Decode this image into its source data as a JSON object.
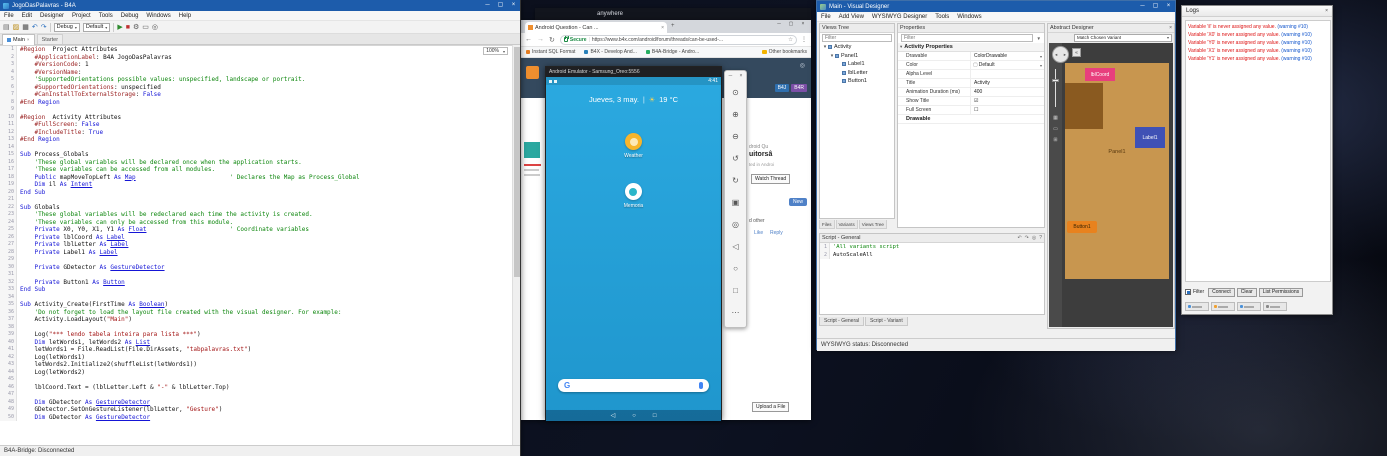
{
  "glyphs": {
    "minimize": "─",
    "maximize": "▢",
    "close": "×",
    "dropdown": "▾",
    "back": "←",
    "forward": "→",
    "reload": "↻",
    "star": "☆",
    "overflow": "⋮",
    "newtab": "+",
    "left_collapse": "«",
    "search": "◎",
    "dpad_left": "◂",
    "dpad_right": "▸",
    "funnel": "▼",
    "expander": "▾"
  },
  "background_window": {
    "title": "anywhere"
  },
  "ide": {
    "title": "JogoDasPalavras - B4A",
    "menus": [
      "File",
      "Edit",
      "Designer",
      "Project",
      "Tools",
      "Debug",
      "Windows",
      "Help"
    ],
    "toolbar_icons_left": [
      {
        "name": "new-file-icon",
        "glyph": "▤",
        "color": "#666"
      },
      {
        "name": "open-file-icon",
        "glyph": "▨",
        "color": "#b8860b"
      },
      {
        "name": "save-icon",
        "glyph": "▦",
        "color": "#444"
      },
      {
        "name": "undo-icon",
        "glyph": "↶",
        "color": "#2a6fbf"
      },
      {
        "name": "redo-icon",
        "glyph": "↷",
        "color": "#2a6fbf"
      }
    ],
    "build_config": "Debug",
    "profile": "Default",
    "toolbar_icons_right": [
      {
        "name": "run-icon",
        "glyph": "▶",
        "color": "#2e8b2e"
      },
      {
        "name": "stop-icon",
        "glyph": "■",
        "color": "#c03030"
      },
      {
        "name": "compile-icon",
        "glyph": "⚙",
        "color": "#555"
      },
      {
        "name": "designer-icon",
        "glyph": "▭",
        "color": "#555"
      },
      {
        "name": "bridge-icon",
        "glyph": "◎",
        "color": "#555"
      }
    ],
    "tabs": [
      "Main",
      "Starter"
    ],
    "zoom": "100%",
    "status": "B4A-Bridge: Disconnected",
    "code_lines": [
      "#Region  Project Attributes",
      "    #ApplicationLabel: B4A JogoDasPalavras",
      "    #VersionCode: 1",
      "    #VersionName: ",
      "    'SupportedOrientations possible values: unspecified, landscape or portrait.",
      "    #SupportedOrientations: unspecified",
      "    #CanInstallToExternalStorage: False",
      "#End Region",
      "",
      "#Region  Activity Attributes",
      "    #FullScreen: False",
      "    #IncludeTitle: True",
      "#End Region",
      "",
      "Sub Process_Globals",
      "    'These global variables will be declared once when the application starts.",
      "    'These variables can be accessed from all modules.",
      "    Public mapMoveTopLeft As Map                          ' Declares the Map as Process_Global",
      "    Dim il As Intent",
      "End Sub",
      "",
      "Sub Globals",
      "    'These global variables will be redeclared each time the activity is created.",
      "    'These variables can only be accessed from this module.",
      "    Private X0, Y0, X1, Y1 As Float                       ' Coordinate variables",
      "    Private lblCoord As Label",
      "    Private lblLetter As Label",
      "    Private Label1 As Label",
      "",
      "    Private GDetector As GestureDetector",
      "",
      "    Private Button1 As Button",
      "End Sub",
      "",
      "Sub Activity_Create(FirstTime As Boolean)",
      "    'Do not forget to load the layout file created with the visual designer. For example:",
      "    Activity.LoadLayout(\"Main\")",
      "",
      "    Log(\"*** lendo tabela inteira para lista ***\")",
      "    Dim letWords1, letWords2 As List",
      "    letWords1 = File.ReadList(File.DirAssets, \"tabpalavras.txt\")",
      "    Log(letWords1)",
      "    letWords2.Initialize2(shuffleList(letWords1))",
      "    Log(letWords2)",
      "",
      "    lblCoord.Text = (lblLetter.Left & \"-\" & lblLetter.Top)",
      "",
      "    Dim GDetector As GestureDetector",
      "    GDetector.SetOnGestureListener(lblLetter, \"Gesture\")",
      "    Dim GDetector As GestureDetector"
    ]
  },
  "browser": {
    "tab_title": "Android Question - Can ...",
    "security_label": "Secure",
    "url": "https://www.b4x.com/android/forum/threads/can-be-used-...",
    "bookmarks": [
      {
        "label": "Instant SQL Format",
        "color": "#e67e22"
      },
      {
        "label": "B4X - Develop And...",
        "color": "#2980b9"
      },
      {
        "label": "B4A-Bridge - Andro...",
        "color": "#27ae60"
      }
    ],
    "other_bookmarks": "Other bookmarks",
    "page": {
      "product_tabs": [
        {
          "label": "B4J",
          "color": "#2f6fae"
        },
        {
          "label": "B4R",
          "color": "#7b4fa6"
        }
      ],
      "fragment_category": "droid Qu",
      "fragment_title": "uitorsâ",
      "fragment_meta": "ted in Androi",
      "watch_thread": "Watch Thread",
      "new_button": "New",
      "fragment_body": "d other",
      "like": "Like",
      "reply": "Reply",
      "upload_button": "Upload a File"
    }
  },
  "emulator": {
    "title": "Android Emulator - Samsung_Oreo:5556",
    "clock": "4:41",
    "date": "Jueves, 3 may.",
    "separator": "|",
    "weather_glyph": "☀",
    "temperature": "19 °C",
    "apps": [
      {
        "label": "Weather",
        "bg": "#f7b52c",
        "fg": "#fde9b8"
      },
      {
        "label": "Memoria",
        "bg": "#ffffff",
        "fg": "#2bb6c9"
      }
    ],
    "search_g": "G",
    "nav": [
      {
        "name": "nav-back-icon",
        "glyph": "◁"
      },
      {
        "name": "nav-home-icon",
        "glyph": "○"
      },
      {
        "name": "nav-overview-icon",
        "glyph": "□"
      }
    ],
    "toolbar_icons": [
      {
        "name": "power-icon",
        "glyph": "⊙"
      },
      {
        "name": "volume-up-icon",
        "glyph": "⊕"
      },
      {
        "name": "volume-down-icon",
        "glyph": "⊖"
      },
      {
        "name": "rotate-left-icon",
        "glyph": "↺"
      },
      {
        "name": "rotate-right-icon",
        "glyph": "↻"
      },
      {
        "name": "screenshot-icon",
        "glyph": "▣"
      },
      {
        "name": "zoom-icon",
        "glyph": "◎"
      },
      {
        "name": "back-icon",
        "glyph": "◁"
      },
      {
        "name": "home-icon",
        "glyph": "○"
      },
      {
        "name": "overview-icon",
        "glyph": "□"
      },
      {
        "name": "more-icon",
        "glyph": "⋯"
      }
    ]
  },
  "designer": {
    "title": "Main - Visual Designer",
    "menus": [
      "File",
      "Add View",
      "WYSIWYG Designer",
      "Tools",
      "Windows"
    ],
    "views_tree": {
      "header": "Views Tree",
      "filter_placeholder": "Filter",
      "items": [
        {
          "label": "Activity",
          "depth": 0,
          "arrow": "▾"
        },
        {
          "label": "Panel1",
          "depth": 1,
          "arrow": "▾"
        },
        {
          "label": "Label1",
          "depth": 2,
          "arrow": ""
        },
        {
          "label": "lblLetter",
          "depth": 2,
          "arrow": ""
        },
        {
          "label": "Button1",
          "depth": 2,
          "arrow": ""
        }
      ],
      "tabs": [
        "Files",
        "Variants",
        "Views Tree"
      ]
    },
    "properties": {
      "header": "Properties",
      "filter_placeholder": "Filter",
      "group": "Activity Properties",
      "rows": [
        {
          "name": "Drawable",
          "value": "ColorDrawable",
          "suffix": "▾",
          "prefix": ""
        },
        {
          "name": "Color",
          "value": "Default",
          "suffix": "▾",
          "prefix": "▢"
        },
        {
          "name": "Alpha Level",
          "value": "",
          "suffix": "",
          "prefix": ""
        },
        {
          "name": "Title",
          "value": "Activity",
          "suffix": "",
          "prefix": ""
        },
        {
          "name": "Animation Duration (ms)",
          "value": "400",
          "suffix": "",
          "prefix": ""
        },
        {
          "name": "Show Title",
          "value": "☑",
          "suffix": "",
          "prefix": ""
        },
        {
          "name": "Full Screen",
          "value": "☐",
          "suffix": "",
          "prefix": ""
        }
      ],
      "section2": "Drawable"
    },
    "abstract": {
      "header": "Abstract Designer",
      "variant": "Match Chosen Variant",
      "strip_icons": [
        {
          "name": "grid-icon",
          "glyph": "▦"
        },
        {
          "name": "screen-icon",
          "glyph": "▭"
        },
        {
          "name": "zoom-grid-icon",
          "glyph": "⊞"
        }
      ],
      "canvas_views": {
        "panel_label": "Panel1",
        "lblcoord_label": "lblCoord",
        "label1_label": "Label1",
        "button1_label": "Button1"
      },
      "colors": {
        "canvas": "#3d3d3d",
        "panel_bg": "#c8964f",
        "inner_panel": "#8a5a20",
        "lblcoord_bg": "#e83f7d",
        "label1_bg": "#3f51b5",
        "button1_bg": "#e8821e"
      }
    },
    "script": {
      "header": "Script - General",
      "toolbar": [
        {
          "name": "undo-icon",
          "glyph": "↶"
        },
        {
          "name": "redo-icon",
          "glyph": "↷"
        },
        {
          "name": "find-icon",
          "glyph": "◎"
        },
        {
          "name": "help-icon",
          "glyph": "?"
        }
      ],
      "lines": [
        "'All variants script",
        "AutoScaleAll"
      ],
      "tabs": [
        "Script - General",
        "Script - Variant"
      ],
      "status": "WYSIWYG status: Disconnected"
    }
  },
  "logs": {
    "title": "Logs",
    "entries": [
      {
        "text": "Variable 'il' is never assigned any value.",
        "ref": " (warning #10)"
      },
      {
        "text": "Variable 'X0' is never assigned any value.",
        "ref": " (warning #10)"
      },
      {
        "text": "Variable 'Y0' is never assigned any value.",
        "ref": " (warning #10)"
      },
      {
        "text": "Variable 'X1' is never assigned any value.",
        "ref": " (warning #10)"
      },
      {
        "text": "Variable 'Y1' is never assigned any value.",
        "ref": " (warning #10)"
      }
    ],
    "filter_label": "Filter",
    "buttons": [
      "Connect",
      "Clear",
      "List Permissions"
    ]
  }
}
